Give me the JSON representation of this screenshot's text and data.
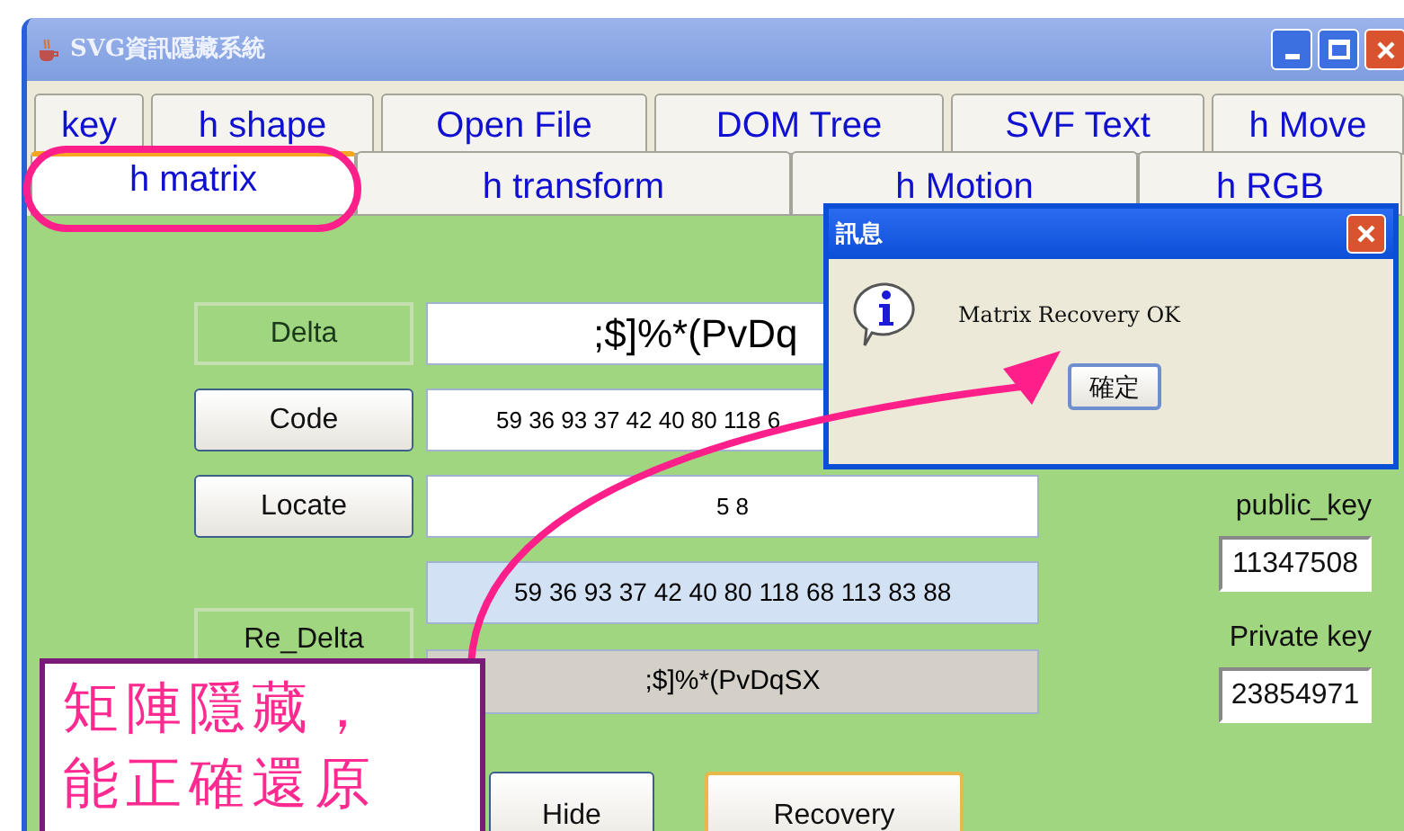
{
  "window": {
    "title": "SVG資訊隱藏系統"
  },
  "tab_rows": [
    {
      "tabs": [
        {
          "label": "key",
          "selected": false
        },
        {
          "label": "h shape",
          "selected": false
        },
        {
          "label": "Open File",
          "selected": false
        },
        {
          "label": "DOM Tree",
          "selected": false
        },
        {
          "label": "SVF Text",
          "selected": false
        },
        {
          "label": "h Move",
          "selected": false
        }
      ]
    },
    {
      "tabs": [
        {
          "label": "h matrix",
          "selected": true
        },
        {
          "label": "h transform",
          "selected": false
        },
        {
          "label": "h Motion",
          "selected": false
        },
        {
          "label": "h RGB",
          "selected": false
        }
      ]
    }
  ],
  "form": {
    "rows": [
      {
        "label": "Delta",
        "disabled": true,
        "value": ";$]%*(PvDq"
      },
      {
        "label": "Code",
        "disabled": false,
        "value": "59 36 93 37 42 40 80 118 6"
      },
      {
        "label": "Locate",
        "disabled": false,
        "value": "5 8"
      }
    ],
    "code_result": "59 36 93 37 42 40 80 118 68 113 83 88",
    "re_delta": {
      "label": "Re_Delta",
      "value": ";$]%*(PvDqSX"
    },
    "buttons": [
      {
        "label": "Hide",
        "focused": false
      },
      {
        "label": "Recovery",
        "focused": true
      }
    ]
  },
  "keys": [
    {
      "label": "public_key",
      "value": "11347508"
    },
    {
      "label": "Private key",
      "value": "23854971"
    }
  ],
  "dialog": {
    "title": "訊息",
    "message": "Matrix Recovery OK",
    "button": "確定"
  },
  "annotation": {
    "lines": [
      "矩陣隱藏，",
      "能正確還原"
    ]
  }
}
